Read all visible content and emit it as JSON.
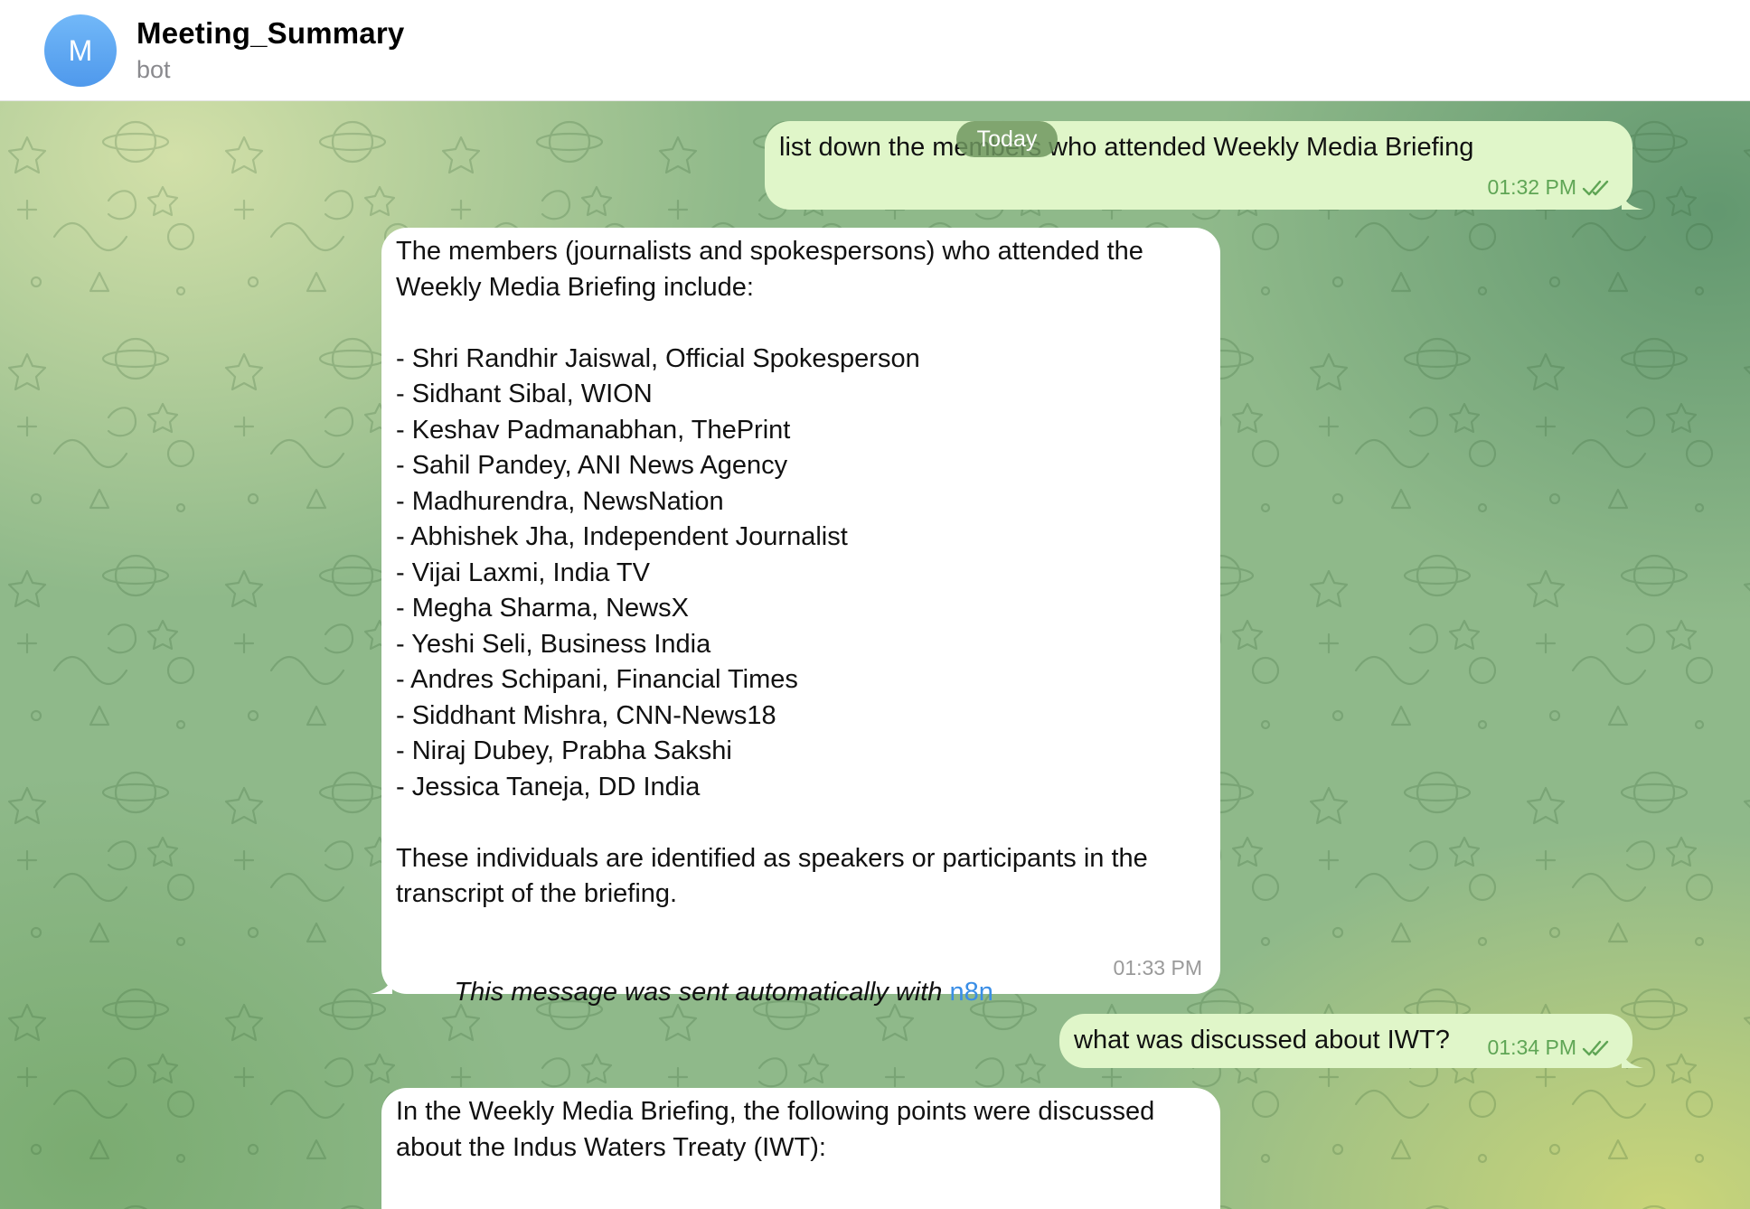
{
  "header": {
    "avatar_letter": "M",
    "title": "Meeting_Summary",
    "subtitle": "bot"
  },
  "date_pill": "Today",
  "messages": {
    "m1": {
      "text": "list down the members who attended Weekly Media Briefing",
      "time": "01:32 PM"
    },
    "m2": {
      "text": "The members (journalists and spokespersons) who attended the\nWeekly Media Briefing include:\n\n- Shri Randhir Jaiswal, Official Spokesperson\n- Sidhant Sibal, WION\n- Keshav Padmanabhan, ThePrint\n- Sahil Pandey, ANI News Agency\n- Madhurendra, NewsNation\n- Abhishek Jha, Independent Journalist\n- Vijai Laxmi, India TV\n- Megha Sharma, NewsX\n- Yeshi Seli, Business India\n- Andres Schipani, Financial Times\n- Siddhant Mishra, CNN-News18\n- Niraj Dubey, Prabha Sakshi\n- Jessica Taneja, DD India\n\nThese individuals are identified as speakers or participants in the\ntranscript of the briefing.",
      "footer_prefix": "This message was sent automatically with ",
      "footer_link": "n8n",
      "time": "01:33 PM"
    },
    "m3": {
      "text": "what was discussed about IWT?",
      "time": "01:34 PM"
    },
    "m4": {
      "text": "In the Weekly Media Briefing, the following points were discussed\nabout the Indus Waters Treaty (IWT):"
    }
  },
  "colors": {
    "outgoing_bubble": "#e0f6c9",
    "incoming_bubble": "#ffffff",
    "check_color": "#5fa555",
    "link": "#3a8ee6",
    "avatar": "#5ea6f2"
  },
  "icons": {
    "read_status": "double-check-icon"
  }
}
